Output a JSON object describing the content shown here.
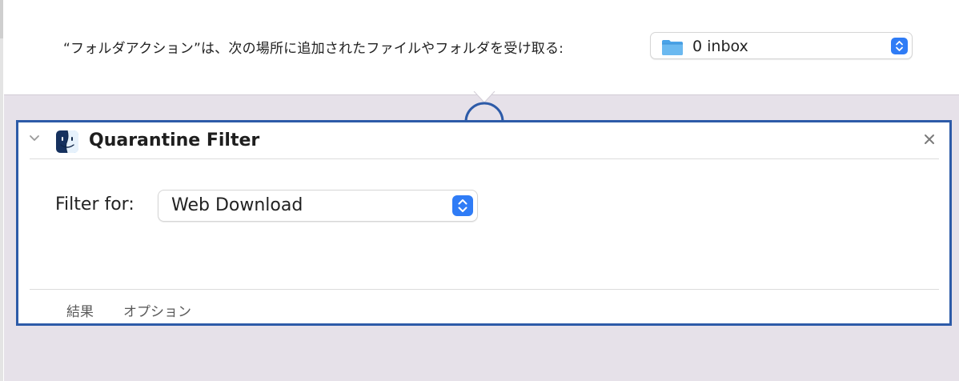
{
  "folder_action": {
    "receive_label": "“フォルダアクション”は、次の場所に追加されたファイルやフォルダを受け取る:",
    "folder_icon": "folder-icon",
    "folder_value": "0 inbox"
  },
  "action": {
    "title": "Quarantine Filter",
    "icon": "finder-icon",
    "filter_label": "Filter for:",
    "filter_value": "Web Download",
    "tabs": [
      {
        "label": "結果"
      },
      {
        "label": "オプション"
      }
    ]
  },
  "colors": {
    "accent": "#2f7cf6",
    "selection_border": "#2d5ba8",
    "workflow_background": "#e6e1e9"
  }
}
